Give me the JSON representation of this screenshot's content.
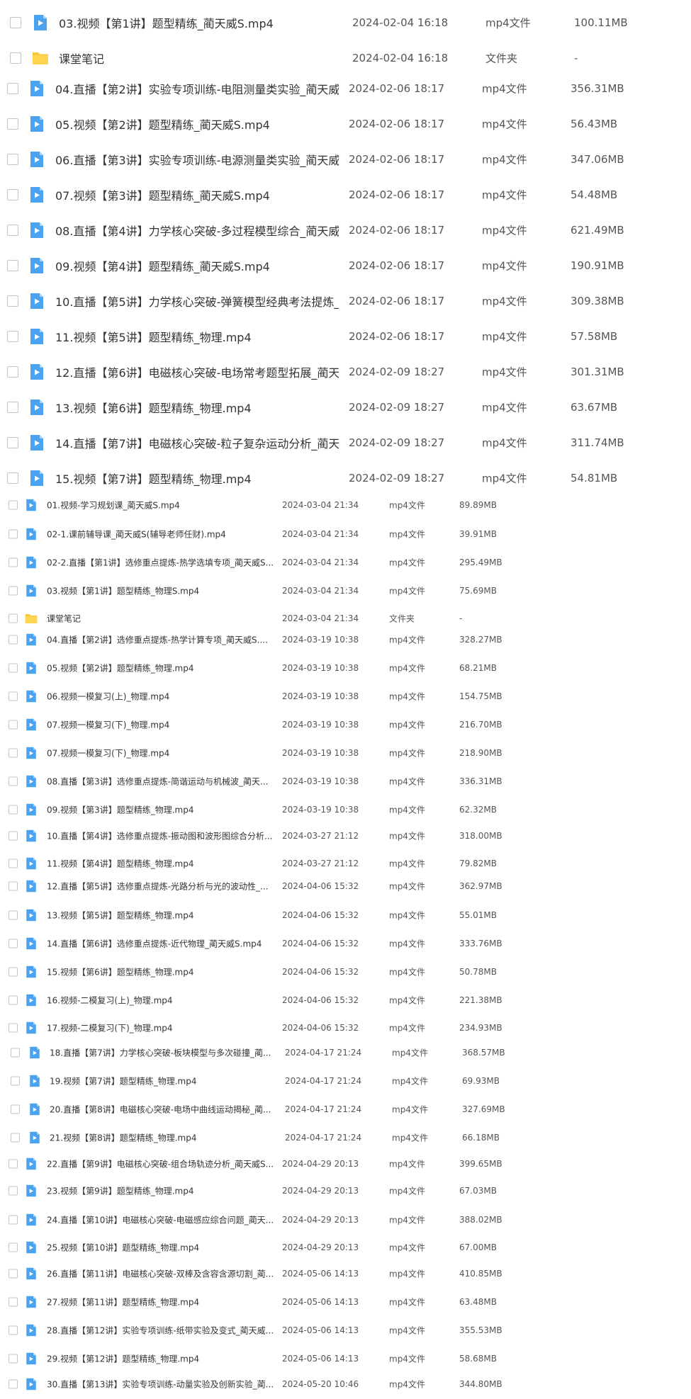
{
  "colors": {
    "video_icon": "#4aa3f0",
    "folder_icon": "#f8c636",
    "text": "#333333",
    "meta_text": "#555555",
    "checkbox_border": "#c4c4c4"
  },
  "icons": {
    "video": "video-file-icon",
    "folder": "folder-icon"
  },
  "files": [
    {
      "name": "03.视频【第1讲】题型精练_蔺天威S.mp4",
      "date": "2024-02-04 16:18",
      "type": "mp4文件",
      "size": "100.11MB",
      "kind": "video"
    },
    {
      "name": "课堂笔记",
      "date": "2024-02-04 16:18",
      "type": "文件夹",
      "size": "-",
      "kind": "folder"
    },
    {
      "name": "04.直播【第2讲】实验专项训练-电阻测量类实验_蔺天威...",
      "date": "2024-02-06 18:17",
      "type": "mp4文件",
      "size": "356.31MB",
      "kind": "video"
    },
    {
      "name": "05.视频【第2讲】题型精练_蔺天威S.mp4",
      "date": "2024-02-06 18:17",
      "type": "mp4文件",
      "size": "56.43MB",
      "kind": "video"
    },
    {
      "name": "06.直播【第3讲】实验专项训练-电源测量类实验_蔺天威...",
      "date": "2024-02-06 18:17",
      "type": "mp4文件",
      "size": "347.06MB",
      "kind": "video"
    },
    {
      "name": "07.视频【第3讲】题型精练_蔺天威S.mp4",
      "date": "2024-02-06 18:17",
      "type": "mp4文件",
      "size": "54.48MB",
      "kind": "video"
    },
    {
      "name": "08.直播【第4讲】力学核心突破-多过程模型综合_蔺天威...",
      "date": "2024-02-06 18:17",
      "type": "mp4文件",
      "size": "621.49MB",
      "kind": "video"
    },
    {
      "name": "09.视频【第4讲】题型精练_蔺天威S.mp4",
      "date": "2024-02-06 18:17",
      "type": "mp4文件",
      "size": "190.91MB",
      "kind": "video"
    },
    {
      "name": "10.直播【第5讲】力学核心突破-弹簧模型经典考法提炼_...",
      "date": "2024-02-06 18:17",
      "type": "mp4文件",
      "size": "309.38MB",
      "kind": "video"
    },
    {
      "name": "11.视频【第5讲】题型精练_物理.mp4",
      "date": "2024-02-06 18:17",
      "type": "mp4文件",
      "size": "57.58MB",
      "kind": "video"
    },
    {
      "name": "12.直播【第6讲】电磁核心突破-电场常考题型拓展_蔺天...",
      "date": "2024-02-09 18:27",
      "type": "mp4文件",
      "size": "301.31MB",
      "kind": "video"
    },
    {
      "name": "13.视频【第6讲】题型精练_物理.mp4",
      "date": "2024-02-09 18:27",
      "type": "mp4文件",
      "size": "63.67MB",
      "kind": "video"
    },
    {
      "name": "14.直播【第7讲】电磁核心突破-粒子复杂运动分析_蔺天...",
      "date": "2024-02-09 18:27",
      "type": "mp4文件",
      "size": "311.74MB",
      "kind": "video"
    },
    {
      "name": "15.视频【第7讲】题型精练_物理.mp4",
      "date": "2024-02-09 18:27",
      "type": "mp4文件",
      "size": "54.81MB",
      "kind": "video"
    },
    {
      "name": "01.视频-学习规划课_蔺天威S.mp4",
      "date": "2024-03-04 21:34",
      "type": "mp4文件",
      "size": "89.89MB",
      "kind": "video"
    },
    {
      "name": "02-1.课前辅导课_蔺天威S(辅导老师任财).mp4",
      "date": "2024-03-04 21:34",
      "type": "mp4文件",
      "size": "39.91MB",
      "kind": "video"
    },
    {
      "name": "02-2.直播【第1讲】选修重点提炼-热学选填专项_蔺天威S...",
      "date": "2024-03-04 21:34",
      "type": "mp4文件",
      "size": "295.49MB",
      "kind": "video"
    },
    {
      "name": "03.视频【第1讲】题型精练_物理S.mp4",
      "date": "2024-03-04 21:34",
      "type": "mp4文件",
      "size": "75.69MB",
      "kind": "video"
    },
    {
      "name": "课堂笔记",
      "date": "2024-03-04 21:34",
      "type": "文件夹",
      "size": "-",
      "kind": "folder"
    },
    {
      "name": "04.直播【第2讲】选修重点提炼-热学计算专项_蔺天威S....",
      "date": "2024-03-19 10:38",
      "type": "mp4文件",
      "size": "328.27MB",
      "kind": "video"
    },
    {
      "name": "05.视频【第2讲】题型精练_物理.mp4",
      "date": "2024-03-19 10:38",
      "type": "mp4文件",
      "size": "68.21MB",
      "kind": "video"
    },
    {
      "name": "06.视频一模复习(上)_物理.mp4",
      "date": "2024-03-19 10:38",
      "type": "mp4文件",
      "size": "154.75MB",
      "kind": "video"
    },
    {
      "name": "07.视频一模复习(下)_物理.mp4",
      "date": "2024-03-19 10:38",
      "type": "mp4文件",
      "size": "216.70MB",
      "kind": "video"
    },
    {
      "name": "07.视频一模复习(下)_物理.mp4",
      "date": "2024-03-19 10:38",
      "type": "mp4文件",
      "size": "218.90MB",
      "kind": "video"
    },
    {
      "name": "08.直播【第3讲】选修重点提炼-简谐运动与机械波_蔺天...",
      "date": "2024-03-19 10:38",
      "type": "mp4文件",
      "size": "336.31MB",
      "kind": "video"
    },
    {
      "name": "09.视频【第3讲】题型精练_物理.mp4",
      "date": "2024-03-19 10:38",
      "type": "mp4文件",
      "size": "62.32MB",
      "kind": "video"
    },
    {
      "name": "10.直播【第4讲】选修重点提炼-振动图和波形图综合分析...",
      "date": "2024-03-27 21:12",
      "type": "mp4文件",
      "size": "318.00MB",
      "kind": "video"
    },
    {
      "name": "11.视频【第4讲】题型精练_物理.mp4",
      "date": "2024-03-27 21:12",
      "type": "mp4文件",
      "size": "79.82MB",
      "kind": "video"
    },
    {
      "name": "12.直播【第5讲】选修重点提炼-光路分析与光的波动性_...",
      "date": "2024-04-06 15:32",
      "type": "mp4文件",
      "size": "362.97MB",
      "kind": "video"
    },
    {
      "name": "13.视频【第5讲】题型精练_物理.mp4",
      "date": "2024-04-06 15:32",
      "type": "mp4文件",
      "size": "55.01MB",
      "kind": "video"
    },
    {
      "name": "14.直播【第6讲】选修重点提炼-近代物理_蔺天威S.mp4",
      "date": "2024-04-06 15:32",
      "type": "mp4文件",
      "size": "333.76MB",
      "kind": "video"
    },
    {
      "name": "15.视频【第6讲】题型精练_物理.mp4",
      "date": "2024-04-06 15:32",
      "type": "mp4文件",
      "size": "50.78MB",
      "kind": "video"
    },
    {
      "name": "16.视频-二模复习(上)_物理.mp4",
      "date": "2024-04-06 15:32",
      "type": "mp4文件",
      "size": "221.38MB",
      "kind": "video"
    },
    {
      "name": "17.视频-二模复习(下)_物理.mp4",
      "date": "2024-04-06 15:32",
      "type": "mp4文件",
      "size": "234.93MB",
      "kind": "video"
    },
    {
      "name": "18.直播【第7讲】力学核心突破-板块模型与多次碰撞_蔺...",
      "date": "2024-04-17 21:24",
      "type": "mp4文件",
      "size": "368.57MB",
      "kind": "video"
    },
    {
      "name": "19.视频【第7讲】题型精练_物理.mp4",
      "date": "2024-04-17 21:24",
      "type": "mp4文件",
      "size": "69.93MB",
      "kind": "video"
    },
    {
      "name": "20.直播【第8讲】电磁核心突破-电场中曲线运动揭秘_蔺...",
      "date": "2024-04-17 21:24",
      "type": "mp4文件",
      "size": "327.69MB",
      "kind": "video"
    },
    {
      "name": "21.视频【第8讲】题型精练_物理.mp4",
      "date": "2024-04-17 21:24",
      "type": "mp4文件",
      "size": "66.18MB",
      "kind": "video"
    },
    {
      "name": "22.直播【第9讲】电磁核心突破-组合场轨迹分析_蔺天威S...",
      "date": "2024-04-29 20:13",
      "type": "mp4文件",
      "size": "399.65MB",
      "kind": "video"
    },
    {
      "name": "23.视频【第9讲】题型精练_物理.mp4",
      "date": "2024-04-29 20:13",
      "type": "mp4文件",
      "size": "67.03MB",
      "kind": "video"
    },
    {
      "name": "24.直播【第10讲】电磁核心突破-电磁感应综合问题_蔺天...",
      "date": "2024-04-29 20:13",
      "type": "mp4文件",
      "size": "388.02MB",
      "kind": "video"
    },
    {
      "name": "25.视频【第10讲】题型精练_物理.mp4",
      "date": "2024-04-29 20:13",
      "type": "mp4文件",
      "size": "67.00MB",
      "kind": "video"
    },
    {
      "name": "26.直播【第11讲】电磁核心突破-双棒及含容含源切割_蔺...",
      "date": "2024-05-06 14:13",
      "type": "mp4文件",
      "size": "410.85MB",
      "kind": "video"
    },
    {
      "name": "27.视频【第11讲】题型精练_物理.mp4",
      "date": "2024-05-06 14:13",
      "type": "mp4文件",
      "size": "63.48MB",
      "kind": "video"
    },
    {
      "name": "28.直播【第12讲】实验专项训练-纸带实验及变式_蔺天威...",
      "date": "2024-05-06 14:13",
      "type": "mp4文件",
      "size": "355.53MB",
      "kind": "video"
    },
    {
      "name": "29.视频【第12讲】题型精练_物理.mp4",
      "date": "2024-05-06 14:13",
      "type": "mp4文件",
      "size": "58.68MB",
      "kind": "video"
    },
    {
      "name": "30.直播【第13讲】实验专项训练-动量实验及创新实验_蔺...",
      "date": "2024-05-20 10:46",
      "type": "mp4文件",
      "size": "344.80MB",
      "kind": "video"
    }
  ]
}
